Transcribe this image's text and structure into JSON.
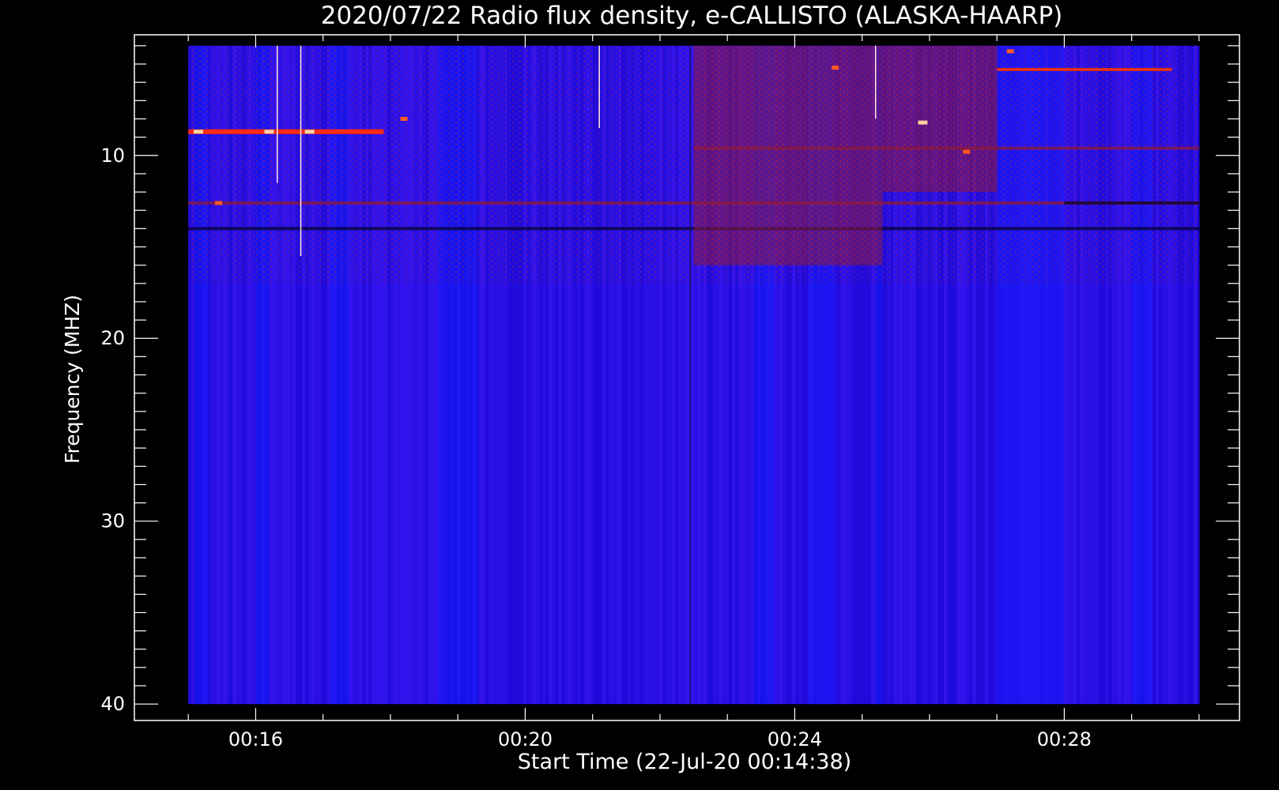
{
  "colors": {
    "background": "#000000",
    "axis": "#ffffff",
    "spectrum_base": "#2a10e8",
    "spectrum_bright": "#0a1cff",
    "burst": "#ff2a10",
    "burst_dark": "#8a1a40"
  },
  "chart_data": {
    "type": "heatmap",
    "title": "2020/07/22  Radio flux density, e-CALLISTO (ALASKA-HAARP)",
    "xlabel": "Start Time (22-Jul-20 00:14:38)",
    "ylabel": "Frequency (MHZ)",
    "x_unit": "minutes after 00:00 UT",
    "xlim": [
      14.2,
      30.6
    ],
    "ylim": [
      40.9,
      3.4
    ],
    "y_inverted": true,
    "data_extent": {
      "x": [
        15.0,
        30.0
      ],
      "y": [
        40.0,
        4.0
      ]
    },
    "x_ticks": [
      {
        "value": 16,
        "label": "00:16"
      },
      {
        "value": 20,
        "label": "00:20"
      },
      {
        "value": 24,
        "label": "00:24"
      },
      {
        "value": 28,
        "label": "00:28"
      }
    ],
    "x_minor_step": 1,
    "y_ticks": [
      {
        "value": 10,
        "label": "10"
      },
      {
        "value": 20,
        "label": "20"
      },
      {
        "value": 30,
        "label": "30"
      },
      {
        "value": 40,
        "label": "40"
      }
    ],
    "y_minor_step": 1,
    "colormap": "blue to red (low to high flux)",
    "features": [
      {
        "kind": "horizontal-band",
        "freq": 8.7,
        "t_start": 15.0,
        "t_end": 17.9,
        "intensity": "high"
      },
      {
        "kind": "horizontal-band",
        "freq": 5.3,
        "t_start": 27.0,
        "t_end": 29.6,
        "intensity": "medium"
      },
      {
        "kind": "horizontal-band",
        "freq": 9.6,
        "t_start": 22.5,
        "t_end": 30.0,
        "intensity": "low"
      },
      {
        "kind": "horizontal-band",
        "freq": 12.6,
        "t_start": 15.0,
        "t_end": 30.0,
        "intensity": "low"
      },
      {
        "kind": "dark-band",
        "freq": 12.6,
        "t_start": 28.0,
        "t_end": 30.0
      },
      {
        "kind": "dark-band",
        "freq": 14.0,
        "t_start": 15.0,
        "t_end": 30.0
      },
      {
        "kind": "region",
        "t_start": 22.5,
        "t_end": 25.3,
        "f_low": 4.0,
        "f_high": 16.0,
        "intensity": "low"
      },
      {
        "kind": "region",
        "t_start": 25.3,
        "t_end": 27.0,
        "f_low": 4.0,
        "f_high": 12.0,
        "intensity": "low"
      },
      {
        "kind": "spike",
        "time": 15.15,
        "freq": 8.7,
        "intensity": "high"
      },
      {
        "kind": "spike",
        "time": 16.2,
        "freq": 8.7,
        "intensity": "high"
      },
      {
        "kind": "spike",
        "time": 16.8,
        "freq": 8.7,
        "intensity": "high"
      },
      {
        "kind": "spike",
        "time": 25.9,
        "freq": 8.2,
        "intensity": "high"
      },
      {
        "kind": "spike",
        "time": 26.55,
        "freq": 9.8,
        "intensity": "medium"
      },
      {
        "kind": "spike",
        "time": 24.6,
        "freq": 5.2,
        "intensity": "medium"
      },
      {
        "kind": "spike",
        "time": 27.2,
        "freq": 4.3,
        "intensity": "medium"
      },
      {
        "kind": "spike",
        "time": 18.2,
        "freq": 8.0,
        "intensity": "medium"
      },
      {
        "kind": "spike",
        "time": 15.45,
        "freq": 12.6,
        "intensity": "medium"
      },
      {
        "kind": "vertical-line",
        "time": 16.32,
        "f_low": 4.0,
        "f_high": 11.5,
        "color": "white"
      },
      {
        "kind": "vertical-line",
        "time": 16.67,
        "f_low": 4.0,
        "f_high": 15.5,
        "color": "white"
      },
      {
        "kind": "vertical-line",
        "time": 21.1,
        "f_low": 4.0,
        "f_high": 8.5,
        "color": "white"
      },
      {
        "kind": "vertical-line",
        "time": 25.2,
        "f_low": 4.0,
        "f_high": 8.0,
        "color": "white"
      },
      {
        "kind": "vertical-line",
        "time": 22.45,
        "f_low": 4.0,
        "f_high": 40.0,
        "color": "dark"
      }
    ]
  }
}
